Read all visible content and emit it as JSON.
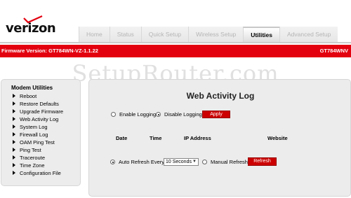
{
  "brand": {
    "logo_text": "verizon"
  },
  "tabs": [
    {
      "label": "Home",
      "active": false
    },
    {
      "label": "Status",
      "active": false
    },
    {
      "label": "Quick Setup",
      "active": false
    },
    {
      "label": "Wireless Setup",
      "active": false
    },
    {
      "label": "Utilities",
      "active": true
    },
    {
      "label": "Advanced Setup",
      "active": false
    }
  ],
  "banner": {
    "firmware": "Firmware Version: GT784WN-VZ-1.1.22",
    "model": "GT784WNV"
  },
  "watermark": "SetupRouter.com",
  "sidebar": {
    "title": "Modem Utilities",
    "items": [
      {
        "label": "Reboot"
      },
      {
        "label": "Restore Defaults"
      },
      {
        "label": "Upgrade Firmware"
      },
      {
        "label": "Web Activity Log"
      },
      {
        "label": "System Log"
      },
      {
        "label": "Firewall Log"
      },
      {
        "label": "OAM Ping Test"
      },
      {
        "label": "Ping Test"
      },
      {
        "label": "Traceroute"
      },
      {
        "label": "Time Zone"
      },
      {
        "label": "Configuration File"
      }
    ]
  },
  "main": {
    "title": "Web Activity Log",
    "logging": {
      "enable_label": "Enable Logging",
      "disable_label": "Disable Logging",
      "selected": "disable",
      "apply_label": "Apply"
    },
    "table_headers": [
      "Date",
      "Time",
      "IP Address",
      "Website"
    ],
    "refresh": {
      "auto_label": "Auto Refresh Every",
      "interval_value": "10 Seconds",
      "manual_label": "Manual Refresh",
      "selected": "auto",
      "refresh_label": "Refresh"
    }
  }
}
